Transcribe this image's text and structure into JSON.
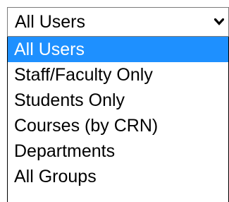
{
  "select": {
    "value": "All Users",
    "arrow_icon": "chevron-down-icon"
  },
  "options": [
    {
      "label": "All Users",
      "selected": true
    },
    {
      "label": "Staff/Faculty Only",
      "selected": false
    },
    {
      "label": "Students Only",
      "selected": false
    },
    {
      "label": "Courses (by CRN)",
      "selected": false
    },
    {
      "label": "Departments",
      "selected": false
    },
    {
      "label": "All Groups",
      "selected": false
    }
  ],
  "colors": {
    "highlight": "#1e90ff",
    "highlight_text": "#ffffff",
    "text": "#000000",
    "border": "#7a7a7a"
  }
}
